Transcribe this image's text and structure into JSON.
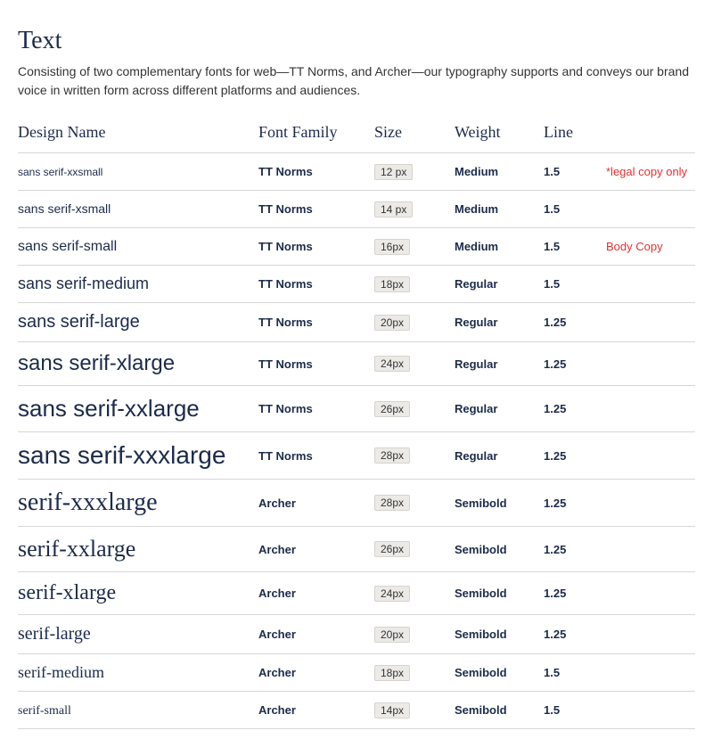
{
  "title": "Text",
  "intro": "Consisting of two complementary fonts for web—TT Norms, and Archer—our typography supports and conveys our brand voice in written form across different platforms and audiences.",
  "headers": {
    "name": "Design Name",
    "family": "Font Family",
    "size": "Size",
    "weight": "Weight",
    "line": "Line"
  },
  "rows": [
    {
      "name": "sans serif-xxsmall",
      "family": "TT Norms",
      "size": "12 px",
      "weight": "Medium",
      "line": "1.5",
      "note": "*legal copy only",
      "cls": "sans sz12"
    },
    {
      "name": "sans serif-xsmall",
      "family": "TT Norms",
      "size": "14 px",
      "weight": "Medium",
      "line": "1.5",
      "note": "",
      "cls": "sans sz14"
    },
    {
      "name": "sans serif-small",
      "family": "TT Norms",
      "size": "16px",
      "weight": "Medium",
      "line": "1.5",
      "note": "Body Copy",
      "cls": "sans sz16"
    },
    {
      "name": "sans serif-medium",
      "family": "TT Norms",
      "size": "18px",
      "weight": "Regular",
      "line": "1.5",
      "note": "",
      "cls": "sans sz18"
    },
    {
      "name": "sans serif-large",
      "family": "TT Norms",
      "size": "20px",
      "weight": "Regular",
      "line": "1.25",
      "note": "",
      "cls": "sans sz20"
    },
    {
      "name": "sans serif-xlarge",
      "family": "TT Norms",
      "size": "24px",
      "weight": "Regular",
      "line": "1.25",
      "note": "",
      "cls": "sans sz24"
    },
    {
      "name": "sans serif-xxlarge",
      "family": "TT Norms",
      "size": "26px",
      "weight": "Regular",
      "line": "1.25",
      "note": "",
      "cls": "sans sz26"
    },
    {
      "name": "sans serif-xxxlarge",
      "family": "TT Norms",
      "size": "28px",
      "weight": "Regular",
      "line": "1.25",
      "note": "",
      "cls": "sans sz28"
    },
    {
      "name": "serif-xxxlarge",
      "family": "Archer",
      "size": "28px",
      "weight": "Semibold",
      "line": "1.25",
      "note": "",
      "cls": "serif sz28"
    },
    {
      "name": "serif-xxlarge",
      "family": "Archer",
      "size": "26px",
      "weight": "Semibold",
      "line": "1.25",
      "note": "",
      "cls": "serif sz26"
    },
    {
      "name": "serif-xlarge",
      "family": "Archer",
      "size": "24px",
      "weight": "Semibold",
      "line": "1.25",
      "note": "",
      "cls": "serif sz24"
    },
    {
      "name": "serif-large",
      "family": "Archer",
      "size": "20px",
      "weight": "Semibold",
      "line": "1.25",
      "note": "",
      "cls": "serif sz20"
    },
    {
      "name": "serif-medium",
      "family": "Archer",
      "size": "18px",
      "weight": "Semibold",
      "line": "1.5",
      "note": "",
      "cls": "serif sz18"
    },
    {
      "name": "serif-small",
      "family": "Archer",
      "size": "14px",
      "weight": "Semibold",
      "line": "1.5",
      "note": "",
      "cls": "serif sz14"
    }
  ]
}
